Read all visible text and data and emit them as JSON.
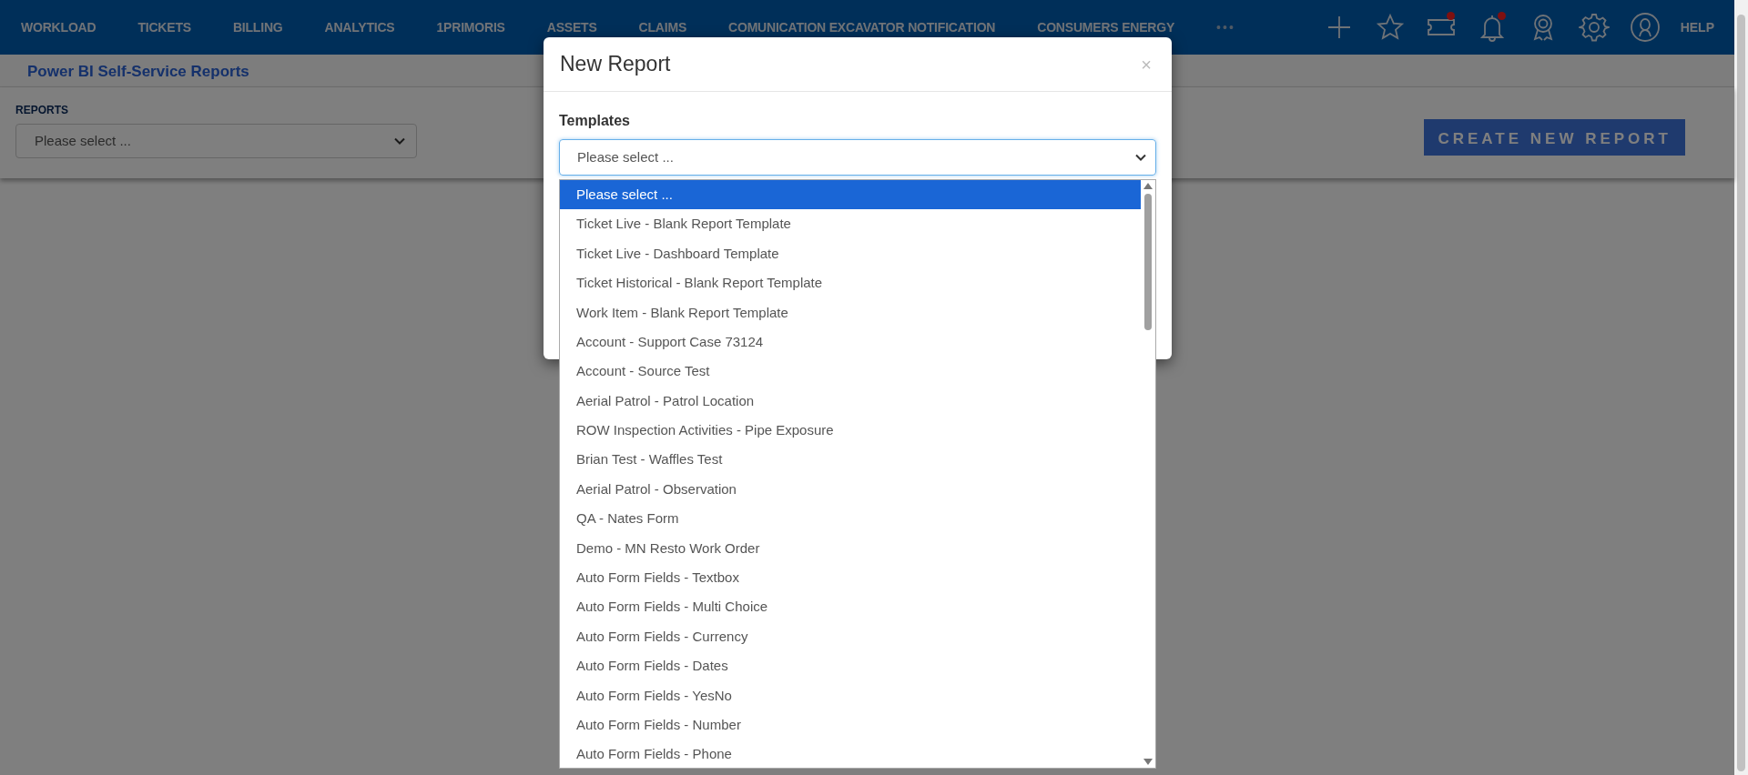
{
  "nav": {
    "items": [
      {
        "label": "WORKLOAD"
      },
      {
        "label": "TICKETS"
      },
      {
        "label": "BILLING"
      },
      {
        "label": "ANALYTICS"
      },
      {
        "label": "1PRIMORIS"
      },
      {
        "label": "ASSETS"
      },
      {
        "label": "CLAIMS"
      },
      {
        "label": "COMUNICATION EXCAVATOR NOTIFICATION"
      },
      {
        "label": "CONSUMERS ENERGY"
      }
    ],
    "more": "•••",
    "icons": [
      {
        "kind": "plus"
      },
      {
        "kind": "star"
      },
      {
        "kind": "ticket",
        "alert": true
      },
      {
        "kind": "bell",
        "alert": true
      },
      {
        "kind": "award"
      },
      {
        "kind": "gear"
      },
      {
        "kind": "user"
      }
    ],
    "help": "HELP"
  },
  "page": {
    "title": "Power BI Self-Service Reports",
    "reports_label": "REPORTS",
    "reports_select": "Please select ...",
    "create_button": "CREATE NEW REPORT"
  },
  "modal": {
    "title": "New Report",
    "close": "×",
    "templates_label": "Templates",
    "templates_select": "Please select ...",
    "options": [
      {
        "label": "Please select ...",
        "selected": true
      },
      {
        "label": "Ticket Live - Blank Report Template",
        "selected": false
      },
      {
        "label": "Ticket Live - Dashboard Template",
        "selected": false
      },
      {
        "label": "Ticket Historical - Blank Report Template",
        "selected": false
      },
      {
        "label": "Work Item - Blank Report Template",
        "selected": false
      },
      {
        "label": "Account - Support Case 73124",
        "selected": false
      },
      {
        "label": "Account - Source Test",
        "selected": false
      },
      {
        "label": "Aerial Patrol - Patrol Location",
        "selected": false
      },
      {
        "label": "ROW Inspection Activities - Pipe Exposure",
        "selected": false
      },
      {
        "label": "Brian Test - Waffles Test",
        "selected": false
      },
      {
        "label": "Aerial Patrol - Observation",
        "selected": false
      },
      {
        "label": "QA - Nates Form",
        "selected": false
      },
      {
        "label": "Demo - MN Resto Work Order",
        "selected": false
      },
      {
        "label": "Auto Form Fields - Textbox",
        "selected": false
      },
      {
        "label": "Auto Form Fields - Multi Choice",
        "selected": false
      },
      {
        "label": "Auto Form Fields - Currency",
        "selected": false
      },
      {
        "label": "Auto Form Fields - Dates",
        "selected": false
      },
      {
        "label": "Auto Form Fields - YesNo",
        "selected": false
      },
      {
        "label": "Auto Form Fields - Number",
        "selected": false
      },
      {
        "label": "Auto Form Fields - Phone",
        "selected": false
      }
    ]
  }
}
